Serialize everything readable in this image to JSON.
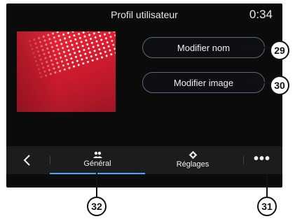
{
  "header": {
    "title": "Profil utilisateur",
    "clock": "0:34"
  },
  "buttons": {
    "modify_name": "Modifier nom",
    "modify_image": "Modifier image"
  },
  "tabs": {
    "back_icon": "chevron-left-icon",
    "general": {
      "label": "Général",
      "icon": "users-icon",
      "selected": true
    },
    "settings": {
      "label": "Réglages",
      "icon": "gear-icon",
      "selected": false
    },
    "more_label": "•••"
  },
  "callouts": {
    "c29": "29",
    "c30": "30",
    "c31": "31",
    "c32": "32"
  },
  "colors": {
    "screen_bg": "#0b0b0b",
    "tab_accent": "#4aa8ff",
    "profile_red": "#d41c2e"
  }
}
